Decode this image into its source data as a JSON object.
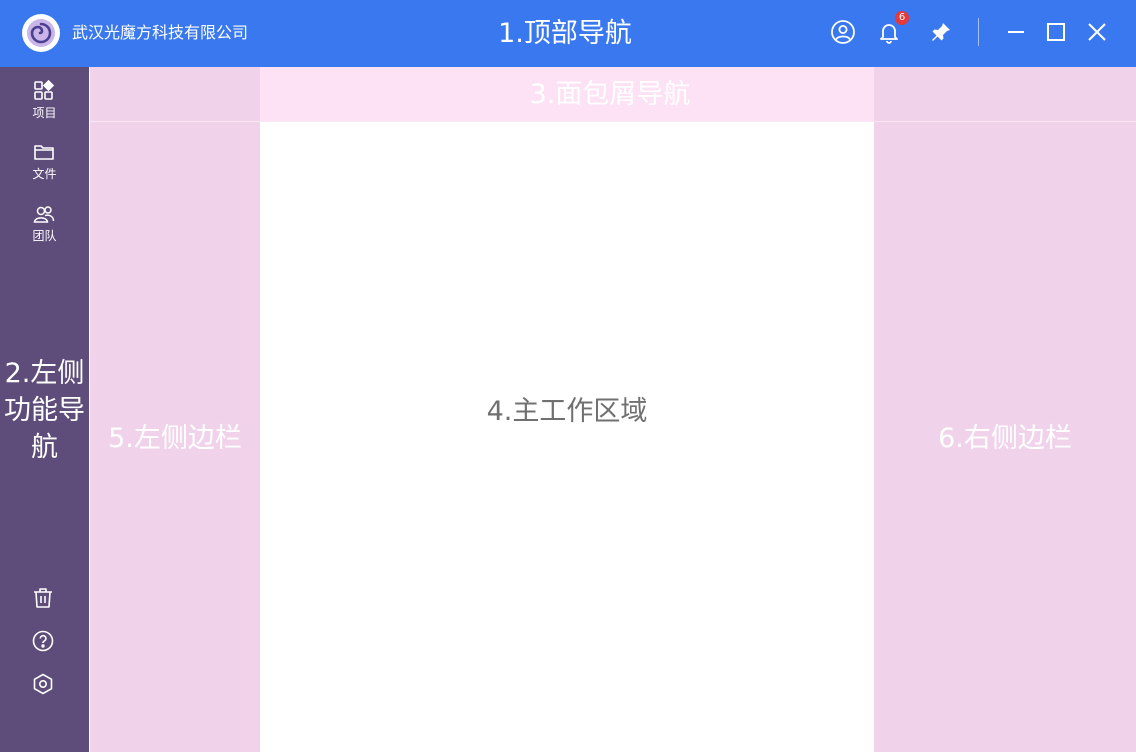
{
  "header": {
    "company_name": "武汉光魔方科技有限公司",
    "title": "1.顶部导航",
    "logo_icon": "swirl-logo-icon",
    "notification_count": "6",
    "icons": [
      "user-circle-icon",
      "bell-icon",
      "pin-icon",
      "minimize-icon",
      "maximize-icon",
      "close-icon"
    ],
    "accent_color": "#3978ee"
  },
  "left_nav": {
    "items": [
      {
        "label": "项目",
        "icon": "grid-icon"
      },
      {
        "label": "文件",
        "icon": "folder-icon"
      },
      {
        "label": "团队",
        "icon": "team-icon"
      }
    ],
    "region_label": "2.左侧功能导航",
    "bottom_icons": [
      "trash-icon",
      "help-icon",
      "settings-icon"
    ],
    "background_color": "#5e4d7a"
  },
  "breadcrumb": {
    "label": "3.面包屑导航"
  },
  "main": {
    "label": "4.主工作区域"
  },
  "left_sidebar": {
    "label": "5.左侧边栏"
  },
  "right_sidebar": {
    "label": "6.右侧边栏"
  },
  "colors": {
    "sidebar_bg": "#f0d3ea",
    "breadcrumb_bg": "#fde1f5"
  }
}
